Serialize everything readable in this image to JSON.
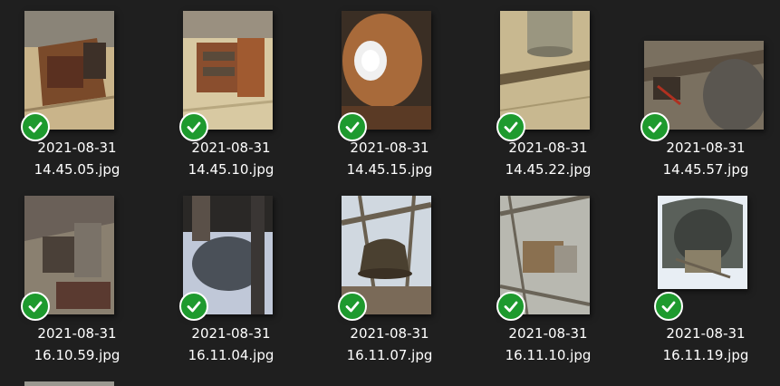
{
  "files": [
    {
      "date": "2021-08-31",
      "name": "14.45.05.jpg",
      "status_icon": "check-icon",
      "colors": [
        "#c9b48a",
        "#7a4a2a",
        "#3d3028"
      ]
    },
    {
      "date": "2021-08-31",
      "name": "14.45.10.jpg",
      "status_icon": "check-icon",
      "colors": [
        "#d8c9a2",
        "#8a4e2e",
        "#5a4a3a"
      ]
    },
    {
      "date": "2021-08-31",
      "name": "14.45.15.jpg",
      "status_icon": "check-icon",
      "colors": [
        "#a86a3a",
        "#f0f0f0",
        "#5a3a25"
      ]
    },
    {
      "date": "2021-08-31",
      "name": "14.45.22.jpg",
      "status_icon": "check-icon",
      "colors": [
        "#c8b890",
        "#9a9680",
        "#6a5a40"
      ]
    },
    {
      "date": "2021-08-31",
      "name": "14.45.57.jpg",
      "status_icon": "check-icon",
      "colors": [
        "#7a7060",
        "#5a5650",
        "#3a3028"
      ]
    },
    {
      "date": "2021-08-31",
      "name": "16.10.59.jpg",
      "status_icon": "check-icon",
      "colors": [
        "#8a8070",
        "#4a4038",
        "#6a6058"
      ]
    },
    {
      "date": "2021-08-31",
      "name": "16.11.04.jpg",
      "status_icon": "check-icon",
      "colors": [
        "#c0c8d8",
        "#4a5058",
        "#2a2826"
      ]
    },
    {
      "date": "2021-08-31",
      "name": "16.11.07.jpg",
      "status_icon": "check-icon",
      "colors": [
        "#d0d8e0",
        "#4a4030",
        "#6a6050"
      ]
    },
    {
      "date": "2021-08-31",
      "name": "16.11.10.jpg",
      "status_icon": "check-icon",
      "colors": [
        "#b8b8b0",
        "#6a6458",
        "#8a7050"
      ]
    },
    {
      "date": "2021-08-31",
      "name": "16.11.19.jpg",
      "status_icon": "check-icon",
      "colors": [
        "#e8eef4",
        "#5a605a",
        "#8a8068"
      ]
    }
  ],
  "accent_colors": {
    "check_green": "#1e9a2e",
    "background": "#1f1f1f",
    "text": "#ffffff"
  }
}
